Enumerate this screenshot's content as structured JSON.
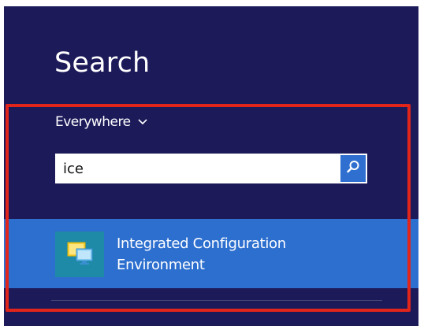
{
  "search_charm": {
    "title": "Search",
    "scope": {
      "label": "Everywhere",
      "icon": "chevron-down-icon"
    },
    "search_box": {
      "value": "ice",
      "button_icon": "search-icon"
    },
    "results": [
      {
        "icon": "app-icon",
        "line1": "Integrated Configuration",
        "line2": "Environment"
      }
    ]
  },
  "colors": {
    "background": "#1c1a59",
    "accent": "#2d6fcf",
    "highlight_box": "#e1251b",
    "app_tile": "#1f8aa7"
  }
}
